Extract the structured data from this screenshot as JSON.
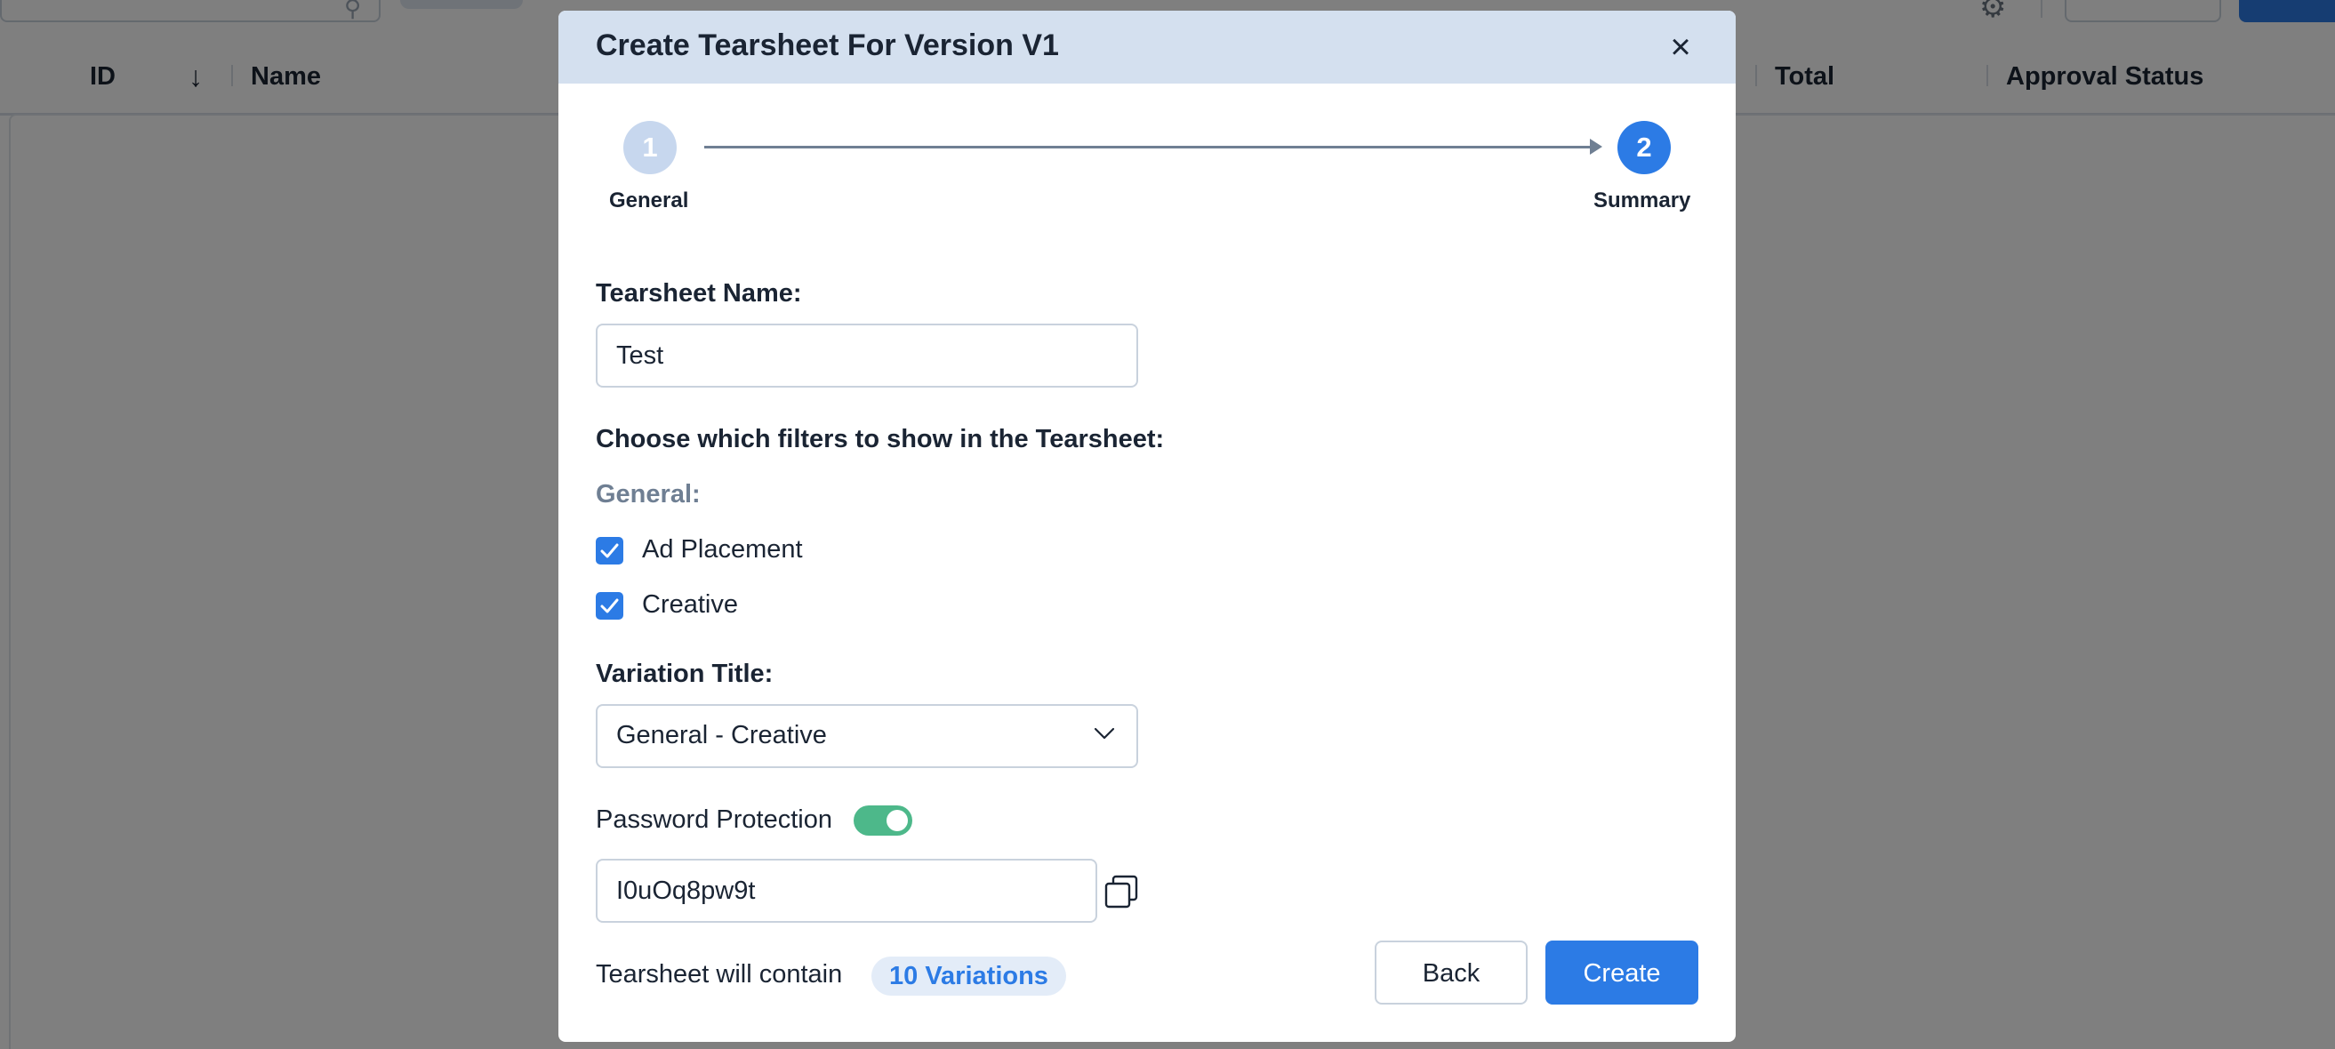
{
  "background": {
    "table_columns": [
      "ID",
      "Name",
      "Total",
      "Approval Status"
    ]
  },
  "modal": {
    "title": "Create Tearsheet For Version V1",
    "close_icon": "close-icon",
    "steps": [
      {
        "number": "1",
        "label": "General",
        "state": "completed"
      },
      {
        "number": "2",
        "label": "Summary",
        "state": "active"
      }
    ],
    "tearsheet_name": {
      "label": "Tearsheet Name:",
      "value": "Test"
    },
    "filters": {
      "heading": "Choose which filters to show in the Tearsheet:",
      "group_label": "General:",
      "items": [
        {
          "label": "Ad Placement",
          "checked": true
        },
        {
          "label": "Creative",
          "checked": true
        }
      ]
    },
    "variation_title": {
      "label": "Variation Title:",
      "value": "General - Creative"
    },
    "password": {
      "label": "Password Protection",
      "enabled": true,
      "value": "I0uOq8pw9t",
      "copy_icon": "copy-icon"
    },
    "summary": {
      "text": "Tearsheet will contain",
      "badge": "10 Variations"
    },
    "buttons": {
      "back": "Back",
      "create": "Create"
    }
  },
  "colors": {
    "primary": "#2c7be5",
    "header_bg": "#d4e0ef",
    "toggle_on": "#4db88a",
    "overlay": "rgba(0,0,0,0.5)"
  }
}
